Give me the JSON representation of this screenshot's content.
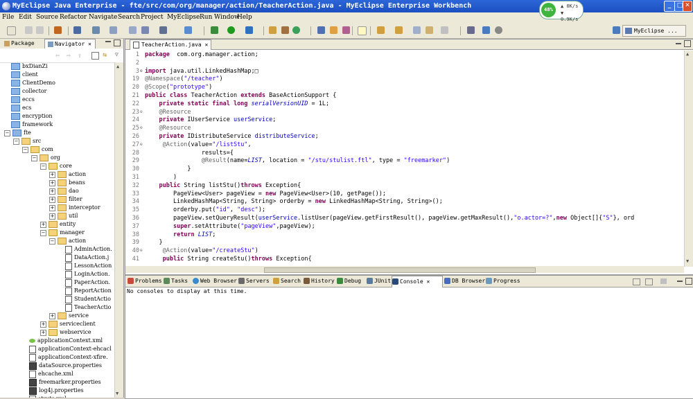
{
  "window": {
    "title": "MyEclipse Java Enterprise - fte/src/com/org/manager/action/TeacherAction.java - MyEclipse Enterprise Workbench",
    "net_monitor": {
      "percent": "48%",
      "up": "0K/s",
      "down": "0.9K/s"
    },
    "controls": {
      "minimize": "_",
      "maximize": "□",
      "close": "✕"
    }
  },
  "menu": [
    "File",
    "Edit",
    "Source",
    "Refactor",
    "Navigate",
    "Search",
    "Project",
    "MyEclipse",
    "Run",
    "Window",
    "Help"
  ],
  "toolbar": {
    "perspective_label": "MyEclipse ..."
  },
  "left_panel": {
    "tabs": [
      "Package Ex",
      "Navigator"
    ],
    "tree": [
      {
        "label": "bxDianZi",
        "depth": 0,
        "icon": "project",
        "expander": ""
      },
      {
        "label": "client",
        "depth": 0,
        "icon": "project",
        "expander": ""
      },
      {
        "label": "ClientDemo",
        "depth": 0,
        "icon": "project",
        "expander": ""
      },
      {
        "label": "collector",
        "depth": 0,
        "icon": "project",
        "expander": ""
      },
      {
        "label": "eccs",
        "depth": 0,
        "icon": "project",
        "expander": ""
      },
      {
        "label": "ecs",
        "depth": 0,
        "icon": "project",
        "expander": ""
      },
      {
        "label": "encryption",
        "depth": 0,
        "icon": "project",
        "expander": ""
      },
      {
        "label": "framework",
        "depth": 0,
        "icon": "project",
        "expander": ""
      },
      {
        "label": "fte",
        "depth": 0,
        "icon": "project",
        "expander": "−"
      },
      {
        "label": "src",
        "depth": 1,
        "icon": "folder",
        "expander": "−"
      },
      {
        "label": "com",
        "depth": 2,
        "icon": "folder",
        "expander": "−"
      },
      {
        "label": "org",
        "depth": 3,
        "icon": "folder",
        "expander": "−"
      },
      {
        "label": "core",
        "depth": 4,
        "icon": "folder",
        "expander": "−"
      },
      {
        "label": "action",
        "depth": 5,
        "icon": "folder",
        "expander": "+"
      },
      {
        "label": "beans",
        "depth": 5,
        "icon": "folder",
        "expander": "+"
      },
      {
        "label": "dao",
        "depth": 5,
        "icon": "folder",
        "expander": "+"
      },
      {
        "label": "filter",
        "depth": 5,
        "icon": "folder",
        "expander": "+"
      },
      {
        "label": "interceptor",
        "depth": 5,
        "icon": "folder",
        "expander": "+"
      },
      {
        "label": "util",
        "depth": 5,
        "icon": "folder",
        "expander": "+"
      },
      {
        "label": "entity",
        "depth": 4,
        "icon": "folder",
        "expander": "+"
      },
      {
        "label": "manager",
        "depth": 4,
        "icon": "folder",
        "expander": "−"
      },
      {
        "label": "action",
        "depth": 5,
        "icon": "folder",
        "expander": "−"
      },
      {
        "label": "AdminAction.",
        "depth": 6,
        "icon": "java",
        "expander": ""
      },
      {
        "label": "DataAction.j",
        "depth": 6,
        "icon": "java",
        "expander": ""
      },
      {
        "label": "LessonAction",
        "depth": 6,
        "icon": "java",
        "expander": ""
      },
      {
        "label": "LoginAction.",
        "depth": 6,
        "icon": "java",
        "expander": ""
      },
      {
        "label": "PaperAction.",
        "depth": 6,
        "icon": "java",
        "expander": ""
      },
      {
        "label": "ReportAction",
        "depth": 6,
        "icon": "java",
        "expander": ""
      },
      {
        "label": "StudentActio",
        "depth": 6,
        "icon": "java",
        "expander": ""
      },
      {
        "label": "TeacherActio",
        "depth": 6,
        "icon": "java",
        "expander": ""
      },
      {
        "label": "service",
        "depth": 5,
        "icon": "folder",
        "expander": "+"
      },
      {
        "label": "serviceclient",
        "depth": 4,
        "icon": "folder",
        "expander": "+"
      },
      {
        "label": "webservice",
        "depth": 4,
        "icon": "folder",
        "expander": "+"
      },
      {
        "label": "applicationContext.xml",
        "depth": 2,
        "icon": "leaf",
        "expander": ""
      },
      {
        "label": "applicationContext-ehcacl",
        "depth": 2,
        "icon": "xml",
        "expander": ""
      },
      {
        "label": "applicationContext-xfire.",
        "depth": 2,
        "icon": "xml",
        "expander": ""
      },
      {
        "label": "dataSource.properties",
        "depth": 2,
        "icon": "props",
        "expander": ""
      },
      {
        "label": "ehcache.xml",
        "depth": 2,
        "icon": "xml",
        "expander": ""
      },
      {
        "label": "freemarker.properties",
        "depth": 2,
        "icon": "props",
        "expander": ""
      },
      {
        "label": "log4j.properties",
        "depth": 2,
        "icon": "props",
        "expander": ""
      },
      {
        "label": "struts.xml",
        "depth": 2,
        "icon": "xml",
        "expander": ""
      }
    ]
  },
  "editor": {
    "tab_label": "TeacherAction.java",
    "lines": [
      {
        "n": "1",
        "fold": "",
        "segs": [
          [
            "k",
            "package"
          ],
          [
            "",
            "  com.org.manager.action;"
          ]
        ]
      },
      {
        "n": "2",
        "fold": "",
        "segs": []
      },
      {
        "n": "3",
        "fold": "⊕",
        "segs": [
          [
            "k",
            "import"
          ],
          [
            "",
            " java.util.LinkedHashMap;□"
          ]
        ]
      },
      {
        "n": "19",
        "fold": "",
        "segs": [
          [
            "a",
            "@Namespace"
          ],
          [
            "",
            "("
          ],
          [
            "s",
            "\"/teacher\""
          ],
          [
            "",
            ")"
          ]
        ]
      },
      {
        "n": "20",
        "fold": "",
        "segs": [
          [
            "a",
            "@Scope"
          ],
          [
            "",
            "("
          ],
          [
            "s",
            "\"prototype\""
          ],
          [
            "",
            ")"
          ]
        ]
      },
      {
        "n": "21",
        "fold": "",
        "segs": [
          [
            "k",
            "public class"
          ],
          [
            "",
            " TeacherAction "
          ],
          [
            "k",
            "extends"
          ],
          [
            "",
            " BaseActionSupport {"
          ]
        ]
      },
      {
        "n": "22",
        "fold": "",
        "segs": [
          [
            "",
            "    "
          ],
          [
            "k",
            "private static final long"
          ],
          [
            " ",
            " "
          ],
          [
            "fi",
            "serialVersionUID"
          ],
          [
            "",
            " = 1L;"
          ]
        ]
      },
      {
        "n": "23",
        "fold": "⊖",
        "segs": [
          [
            "",
            "    "
          ],
          [
            "a",
            "@Resource"
          ]
        ]
      },
      {
        "n": "24",
        "fold": "",
        "segs": [
          [
            "",
            "    "
          ],
          [
            "k",
            "private"
          ],
          [
            "",
            " IUserService "
          ],
          [
            "f",
            "userService"
          ],
          [
            "",
            ";"
          ]
        ]
      },
      {
        "n": "25",
        "fold": "⊖",
        "segs": [
          [
            "",
            "    "
          ],
          [
            "a",
            "@Resource"
          ]
        ]
      },
      {
        "n": "26",
        "fold": "",
        "segs": [
          [
            "",
            "    "
          ],
          [
            "k",
            "private"
          ],
          [
            "",
            " IDistributeService "
          ],
          [
            "f",
            "distributeService"
          ],
          [
            "",
            ";"
          ]
        ]
      },
      {
        "n": "27",
        "fold": "⊖",
        "segs": [
          [
            "",
            "     "
          ],
          [
            "a",
            "@Action"
          ],
          [
            "",
            "(value="
          ],
          [
            "s",
            "\"/listStu\""
          ],
          [
            "",
            ","
          ]
        ]
      },
      {
        "n": "28",
        "fold": "",
        "segs": [
          [
            "",
            "                results={"
          ]
        ]
      },
      {
        "n": "29",
        "fold": "",
        "segs": [
          [
            "",
            "                "
          ],
          [
            "a",
            "@Result"
          ],
          [
            "",
            "(name="
          ],
          [
            "fi",
            "LIST"
          ],
          [
            "",
            ", location = "
          ],
          [
            "s",
            "\"/stu/stulist.ftl\""
          ],
          [
            "",
            ", type = "
          ],
          [
            "s",
            "\"freemarker\""
          ],
          [
            "",
            ")"
          ]
        ]
      },
      {
        "n": "30",
        "fold": "",
        "segs": [
          [
            "",
            "            }"
          ]
        ]
      },
      {
        "n": "31",
        "fold": "",
        "segs": [
          [
            "",
            "        )"
          ]
        ]
      },
      {
        "n": "32",
        "fold": "",
        "segs": [
          [
            "",
            "    "
          ],
          [
            "k",
            "public"
          ],
          [
            "",
            " String listStu()"
          ],
          [
            "k",
            "throws"
          ],
          [
            "",
            " Exception{"
          ]
        ]
      },
      {
        "n": "33",
        "fold": "",
        "segs": [
          [
            "",
            "        PageView<User> pageView = "
          ],
          [
            "k",
            "new"
          ],
          [
            "",
            " PageView<User>(10, getPage());"
          ]
        ]
      },
      {
        "n": "34",
        "fold": "",
        "segs": [
          [
            "",
            "        LinkedHashMap<String, String> orderby = "
          ],
          [
            "k",
            "new"
          ],
          [
            "",
            " LinkedHashMap<String, String>();"
          ]
        ]
      },
      {
        "n": "35",
        "fold": "",
        "segs": [
          [
            "",
            "        orderby.put("
          ],
          [
            "s",
            "\"id\""
          ],
          [
            "",
            ", "
          ],
          [
            "s",
            "\"desc\""
          ],
          [
            "",
            ");"
          ]
        ]
      },
      {
        "n": "36",
        "fold": "",
        "segs": [
          [
            "",
            "        pageView.setQueryResult("
          ],
          [
            "f",
            "userService"
          ],
          [
            "",
            ".listUser(pageView.getFirstResult(), pageView.getMaxResult(),"
          ],
          [
            "s",
            "\"o.actor=?\""
          ],
          [
            "",
            ","
          ],
          [
            "k",
            "new"
          ],
          [
            "",
            " Object[]{"
          ],
          [
            "s",
            "\"S\""
          ],
          [
            "",
            "}, ord"
          ]
        ]
      },
      {
        "n": "37",
        "fold": "",
        "segs": [
          [
            "",
            "        "
          ],
          [
            "k",
            "super"
          ],
          [
            "",
            ".setAttribute("
          ],
          [
            "s",
            "\"pageView\""
          ],
          [
            "",
            ",pageView);"
          ]
        ]
      },
      {
        "n": "38",
        "fold": "",
        "segs": [
          [
            "",
            "        "
          ],
          [
            "k",
            "return"
          ],
          [
            " ",
            " "
          ],
          [
            "fi",
            "LIST"
          ],
          [
            "",
            ";"
          ]
        ]
      },
      {
        "n": "39",
        "fold": "",
        "segs": [
          [
            "",
            "    }"
          ]
        ]
      },
      {
        "n": "40",
        "fold": "⊖",
        "segs": [
          [
            "",
            "     "
          ],
          [
            "a",
            "@Action"
          ],
          [
            "",
            "(value="
          ],
          [
            "s",
            "\"/createStu\""
          ],
          [
            "",
            ")"
          ]
        ]
      },
      {
        "n": "41",
        "fold": "",
        "segs": [
          [
            "",
            "     "
          ],
          [
            "k",
            "public"
          ],
          [
            "",
            " String createStu()"
          ],
          [
            "k",
            "throws"
          ],
          [
            "",
            " Exception{"
          ]
        ]
      }
    ]
  },
  "bottom_panel": {
    "tabs": [
      "Problems",
      "Tasks",
      "Web Browser",
      "Servers",
      "Search",
      "History",
      "Debug",
      "JUnit",
      "Console",
      "DB Browser",
      "Progress"
    ],
    "active_tab": "Console",
    "message": "No consoles to display at this time."
  },
  "colors": {
    "title_bar": "#1a4fc0",
    "chrome": "#ece9d8",
    "keyword": "#7f0055",
    "string": "#2a00ff",
    "field": "#0000c0",
    "annotation": "#646464"
  }
}
